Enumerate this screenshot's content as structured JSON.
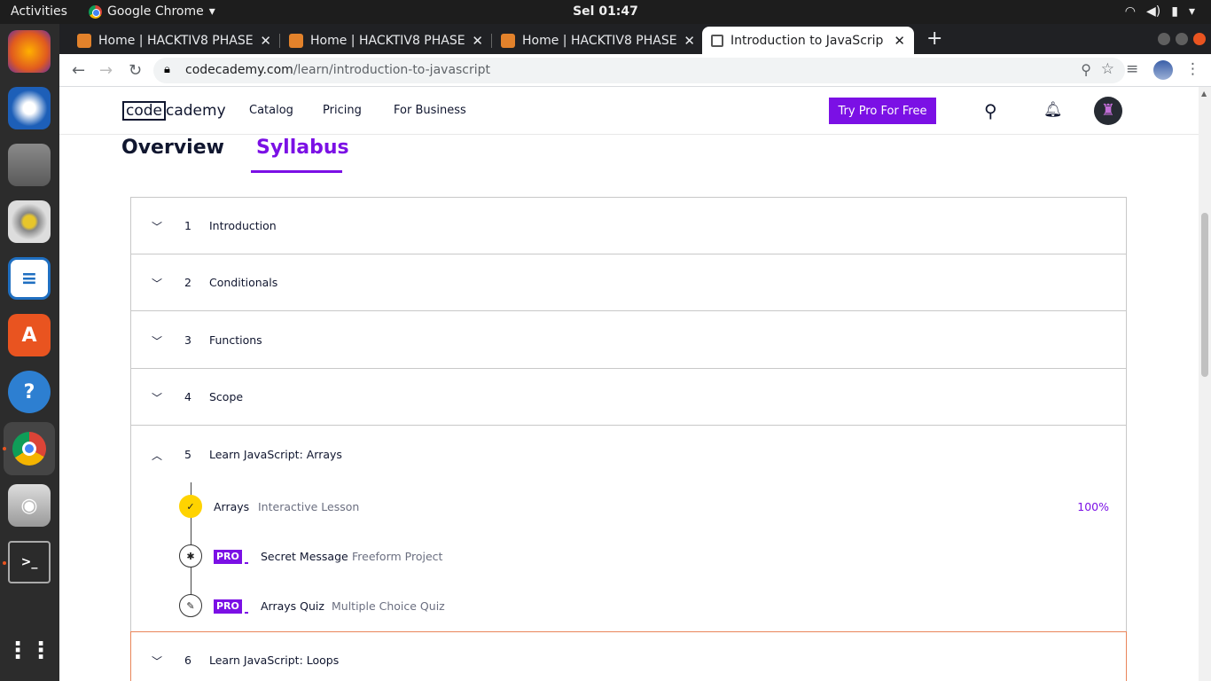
{
  "system": {
    "activities": "Activities",
    "app_name": "Google Chrome",
    "clock": "Sel 01:47",
    "dock_items": [
      "firefox-icon",
      "thunderbird-icon",
      "files-icon",
      "rhythmbox-icon",
      "writer-icon",
      "software-icon",
      "help-icon",
      "chrome-icon",
      "screenshot-icon",
      "terminal-icon",
      "apps-grid-icon"
    ]
  },
  "browser": {
    "tabs": [
      {
        "title": "Home | HACKTIV8 PHASE"
      },
      {
        "title": "Home | HACKTIV8 PHASE"
      },
      {
        "title": "Home | HACKTIV8 PHASE"
      },
      {
        "title": "Introduction to JavaScrip"
      }
    ],
    "url_host": "codecademy.com",
    "url_path": "/learn/introduction-to-javascript"
  },
  "site": {
    "logo_code": "code",
    "logo_rest": "cademy",
    "nav": [
      "Catalog",
      "Pricing",
      "For Business"
    ],
    "cta": "Try Pro For Free",
    "accent": "#7b10e5"
  },
  "page": {
    "tabs": [
      "Overview",
      "Syllabus"
    ],
    "active_tab": "Syllabus",
    "modules": [
      {
        "num": "1",
        "title": "Introduction"
      },
      {
        "num": "2",
        "title": "Conditionals"
      },
      {
        "num": "3",
        "title": "Functions"
      },
      {
        "num": "4",
        "title": "Scope"
      },
      {
        "num": "5",
        "title": "Learn JavaScript: Arrays"
      },
      {
        "num": "6",
        "title": "Learn JavaScript: Loops"
      }
    ],
    "lessons": [
      {
        "name": "Arrays",
        "type": "Interactive Lesson",
        "progress": "100%"
      },
      {
        "badge": "PRO",
        "name": "Secret Message",
        "type": "Freeform Project"
      },
      {
        "badge": "PRO",
        "name": "Arrays Quiz",
        "type": "Multiple Choice Quiz"
      }
    ]
  }
}
